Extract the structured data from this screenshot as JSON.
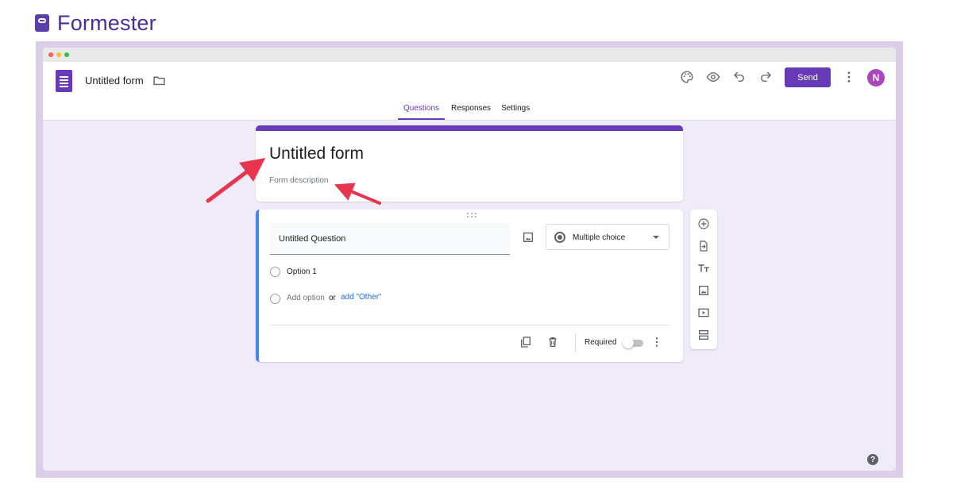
{
  "brand": {
    "name": "Formester"
  },
  "window": {
    "traffic_colors": [
      "#ff5f57",
      "#febc2e",
      "#28c840"
    ]
  },
  "app": {
    "form_title": "Untitled form",
    "send_label": "Send",
    "avatar_initial": "N",
    "accent_color": "#673ab7",
    "toolbar_icons": [
      "palette-icon",
      "preview-eye-icon",
      "undo-icon",
      "redo-icon",
      "more-vert-icon"
    ]
  },
  "tabs": [
    {
      "label": "Questions",
      "active": true
    },
    {
      "label": "Responses",
      "active": false
    },
    {
      "label": "Settings",
      "active": false
    }
  ],
  "title_card": {
    "title": "Untitled form",
    "description_placeholder": "Form description"
  },
  "question": {
    "title": "Untitled Question",
    "type_label": "Multiple choice",
    "options": [
      {
        "label": "Option 1"
      }
    ],
    "add_option_label": "Add option",
    "or_label": "or",
    "add_other_label": "add \"Other\"",
    "required_label": "Required",
    "required_on": false
  },
  "side_toolbar": [
    "add-question-icon",
    "import-questions-icon",
    "add-title-icon",
    "add-image-icon",
    "add-video-icon",
    "add-section-icon"
  ],
  "help": {
    "label": "?"
  }
}
